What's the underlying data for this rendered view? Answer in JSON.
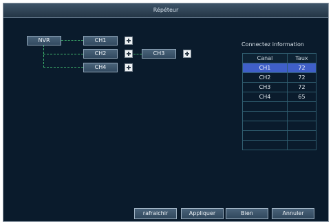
{
  "window": {
    "title": "Répéteur"
  },
  "topology": {
    "nodes": [
      {
        "id": "nvr",
        "label": "NVR"
      },
      {
        "id": "ch1",
        "label": "CH1"
      },
      {
        "id": "ch2",
        "label": "CH2"
      },
      {
        "id": "ch3",
        "label": "CH3"
      },
      {
        "id": "ch4",
        "label": "CH4"
      }
    ]
  },
  "info_panel": {
    "title": "Connectez information",
    "columns": [
      "Canal",
      "Taux"
    ],
    "rows": [
      {
        "canal": "CH1",
        "taux": "72"
      },
      {
        "canal": "CH2",
        "taux": "72"
      },
      {
        "canal": "CH3",
        "taux": "72"
      },
      {
        "canal": "CH4",
        "taux": "65"
      },
      {
        "canal": "",
        "taux": ""
      },
      {
        "canal": "",
        "taux": ""
      },
      {
        "canal": "",
        "taux": ""
      },
      {
        "canal": "",
        "taux": ""
      },
      {
        "canal": "",
        "taux": ""
      }
    ],
    "selected_row": 0,
    "selection_color": "#3f5fc8"
  },
  "buttons": {
    "refresh": "rafraichir",
    "apply": "Appliquer",
    "ok": "Bien",
    "cancel": "Annuler"
  },
  "colors": {
    "background": "#0a1b2c",
    "link_line": "#3fb56e"
  },
  "icons": [
    "plus-icon"
  ]
}
